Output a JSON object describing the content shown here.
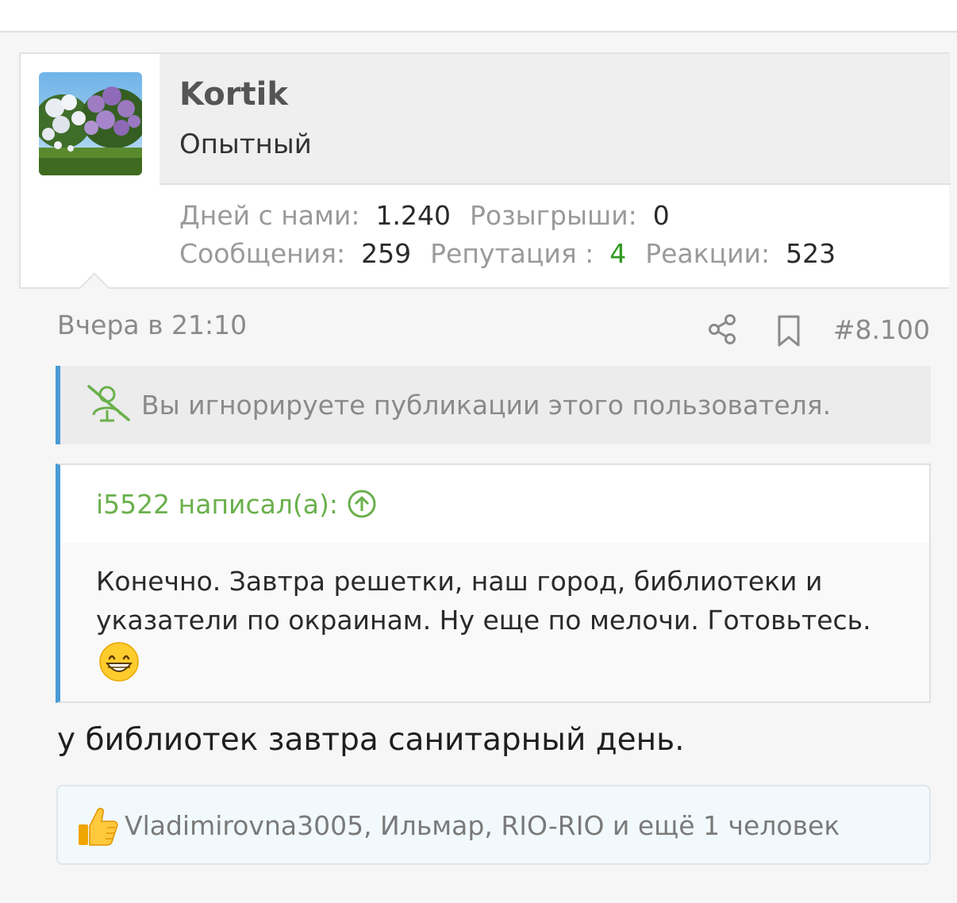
{
  "user": {
    "username": "Kortik",
    "title": "Опытный",
    "avatar": "lilac-bush-photo"
  },
  "stats": {
    "days_label": "Дней с нами:",
    "days_value": "1.240",
    "draws_label": "Розыгрыши:",
    "draws_value": "0",
    "messages_label": "Сообщения:",
    "messages_value": "259",
    "reputation_label": "Репутация :",
    "reputation_value": "4",
    "reactions_label": "Реакции:",
    "reactions_value": "523",
    "reputation_color": "#2f9a1f"
  },
  "post": {
    "time": "Вчера в 21:10",
    "number": "#8.100",
    "ignored_notice": "Вы игнорируете публикации этого пользователя.",
    "text": "у библиотек завтра санитарный день."
  },
  "quote": {
    "author": "i5522 написал(а):",
    "text": "Конечно. Завтра решетки, наш город, библиотеки и указатели по окраинам. Ну еще по мелочи. Готовьтесь.",
    "emoji": "grinning-face-icon"
  },
  "reactions": {
    "text": "Vladimirovna3005, Ильмар, RIO-RIO и ещё 1 человек",
    "icon": "thumbs-up-icon"
  },
  "colors": {
    "accent_blue": "#4a9bd6",
    "quote_author_green": "#6ab04c"
  }
}
